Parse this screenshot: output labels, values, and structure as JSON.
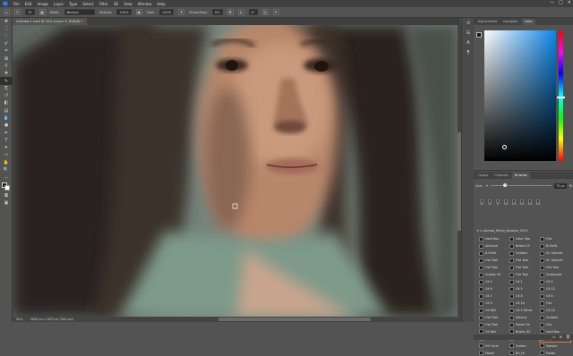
{
  "app": {
    "logo": "Ps"
  },
  "menu": [
    "File",
    "Edit",
    "Image",
    "Layer",
    "Type",
    "Select",
    "Filter",
    "3D",
    "View",
    "Window",
    "Help"
  ],
  "window_controls": [
    "—",
    "□",
    "✕"
  ],
  "options": {
    "mode_label": "Mode:",
    "mode_value": "Normal",
    "opacity_label": "Opacity:",
    "opacity_value": "100%",
    "flow_label": "Flow:",
    "flow_value": "100%",
    "smoothing_label": "Smoothing:",
    "smoothing_value": "0%",
    "angle_value": "0°",
    "brush_size": "75"
  },
  "document": {
    "tab_title": "Untitled-1 Lord @ 50% (Layer 9, RGB/8) *"
  },
  "status": {
    "zoom": "50%",
    "doc_size": "3000 px x 1875 px (300 ppi)"
  },
  "tools": [
    "move",
    "marquee",
    "lasso",
    "quick-select",
    "crop",
    "frame",
    "eyedropper",
    "healing",
    "brush",
    "clone",
    "history",
    "eraser",
    "gradient",
    "blur",
    "dodge",
    "pen",
    "type",
    "path-select",
    "shape",
    "hand",
    "zoom",
    "more"
  ],
  "right_panels": {
    "top_tabs": [
      "Adjustments",
      "Navigator",
      "Color"
    ],
    "top_active": 2,
    "mid_tabs": [
      "Layers",
      "Channels",
      "Brushes"
    ],
    "mid_active": 2,
    "size_label": "Size:",
    "size_value": "75 px",
    "presets": [
      "50",
      "60",
      "75",
      "100",
      "125",
      "150",
      "200",
      "300"
    ],
    "folder": "Ahmad_Hilton_Brushes_2019",
    "brushes": [
      "Hard Rou",
      "Color Stor",
      "Flat",
      "Airbrush",
      "Bristle 25",
      "B-Fluffs",
      "B-Fluffs",
      "Scribble",
      "Gr. Speckle",
      "Flat Tesk",
      "Flat Tesk",
      "Gr. Speckle",
      "Flat Tesk",
      "Flat Tesk",
      "Flat Tesk",
      "Scatter 94",
      "Flat Tesk",
      "Scatterbrd",
      "Oil 4",
      "Oil 1",
      "Oil 5",
      "Oil 6",
      "Oil 5",
      "Oil 12",
      "Oil 7",
      "Oil 8",
      "Oil 6",
      "Oil 9",
      "Oil 10",
      "Flat",
      "Oil Wet",
      "Oil 4 Blend",
      "Oil 20",
      "Flat Tesk",
      "Dalanly",
      "Scribble",
      "Flat Tesk",
      "Pastel Fle",
      "Flat",
      "Oil Wet",
      "Bristle_02",
      "Hard Rou",
      "Oil Wet",
      "Bristle 2",
      "Oil_Smth",
      "Fill Circle",
      "Scatter",
      "Sample",
      "Pastel",
      "Brl_Fe",
      "Pastel"
    ],
    "selected_brush": 44
  },
  "colors": {
    "fg": "#1a1a1a",
    "bg": "#ffffff",
    "accent": "#e07a3b"
  }
}
